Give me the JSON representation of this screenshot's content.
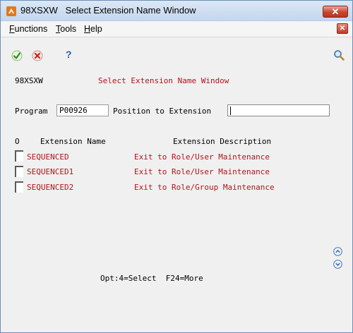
{
  "window": {
    "title_code": "98XSXW",
    "title": "Select Extension Name Window",
    "close_glyph": "✕"
  },
  "menu": {
    "items": [
      {
        "label": "Functions",
        "accel": "F"
      },
      {
        "label": "Tools",
        "accel": "T"
      },
      {
        "label": "Help",
        "accel": "H"
      }
    ],
    "close_glyph": "✕"
  },
  "toolbar": {
    "icons": [
      "ok-check-icon",
      "cancel-x-icon",
      "help-question-icon",
      "search-magnifier-icon"
    ],
    "help_glyph": "?"
  },
  "screen": {
    "program_id": "98XSXW",
    "heading": "Select Extension Name Window",
    "program_label": "Program",
    "program_value": "P00926",
    "position_label": "Position to Extension",
    "position_value": "",
    "columns": {
      "option": "O",
      "name": "Extension Name",
      "description": "Extension Description"
    },
    "rows": [
      {
        "name": "SEQUENCED",
        "description": "Exit to Role/User Maintenance"
      },
      {
        "name": "SEQUENCED1",
        "description": "Exit to Role/User Maintenance"
      },
      {
        "name": "SEQUENCED2",
        "description": "Exit to Role/Group Maintenance"
      }
    ],
    "footer": "Opt:4=Select  F24=More"
  },
  "colors": {
    "text_red": "#b0141c",
    "titlebar": "#c4d7ee",
    "close_red": "#c9452f",
    "help_blue": "#2c5ea8"
  }
}
